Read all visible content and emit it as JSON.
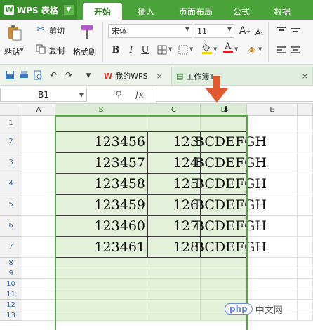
{
  "menu": {
    "app_name": "WPS 表格",
    "tabs": [
      "开始",
      "插入",
      "页面布局",
      "公式",
      "数据"
    ],
    "active_tab": "开始"
  },
  "ribbon": {
    "paste_label": "粘贴",
    "cut_label": "剪切",
    "copy_label": "复制",
    "format_painter_label": "格式刷",
    "font_name": "宋体",
    "font_size": "11",
    "grow_font": "A",
    "shrink_font": "A",
    "bold": "B",
    "italic": "I",
    "underline": "U",
    "font_color_accent": "#e02020",
    "fill_color_accent": "#f2d400"
  },
  "quickbar": {
    "doc_tab_1": "我的WPS",
    "doc_tab_2": "工作簿1",
    "close_glyph": "×"
  },
  "formula": {
    "cell_ref": "B1",
    "fx_label": "fx",
    "value": ""
  },
  "grid": {
    "columns": [
      "A",
      "B",
      "C",
      "D",
      "E"
    ],
    "rows": [
      "1",
      "2",
      "3",
      "4",
      "5",
      "6",
      "7",
      "8",
      "9",
      "10",
      "11",
      "12",
      "13"
    ],
    "data": [
      {
        "b": "123456",
        "c": "123",
        "d": "BCDEFGH"
      },
      {
        "b": "123457",
        "c": "124",
        "d": "BCDEFGH"
      },
      {
        "b": "123458",
        "c": "125",
        "d": "BCDEFGH"
      },
      {
        "b": "123459",
        "c": "126",
        "d": "BCDEFGH"
      },
      {
        "b": "123460",
        "c": "127",
        "d": "BCDEFGH"
      },
      {
        "b": "123461",
        "c": "128",
        "d": "BCDEFGH"
      }
    ]
  },
  "annotation": {
    "arrow_color": "#e05a2f"
  },
  "watermark": {
    "logo": "php",
    "text": "中文网"
  },
  "colors": {
    "menu_green": "#4aa338",
    "selection_fill": "#e3f1da",
    "selection_border": "#5aa84a"
  }
}
